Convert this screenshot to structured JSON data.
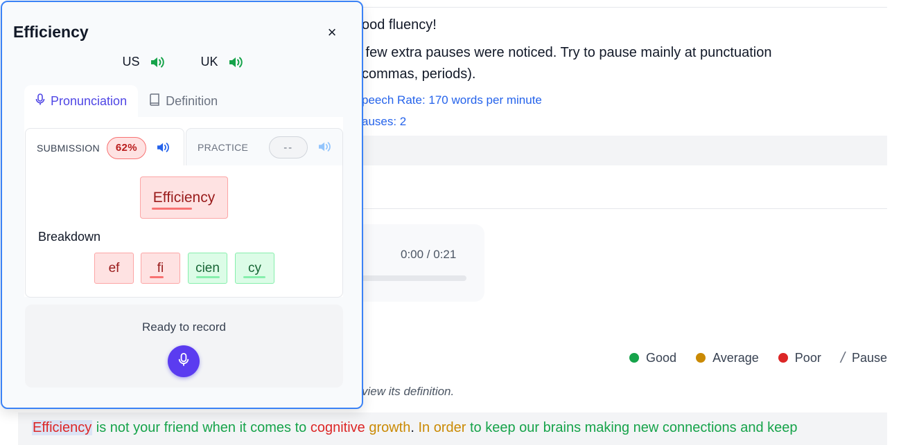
{
  "feedback": {
    "line1": "ood fluency!",
    "line2": " few extra pauses were noticed. Try to pause mainly at punctuation",
    "line3": "commas, periods).",
    "speech_rate": "peech Rate: 170 words per minute",
    "pauses": "auses: 2"
  },
  "audio": {
    "time": "0:00 / 0:21"
  },
  "legend": {
    "items": [
      {
        "label": "Good",
        "color": "#16a34a"
      },
      {
        "label": "Average",
        "color": "#ca8a04"
      },
      {
        "label": "Poor",
        "color": "#dc2626"
      }
    ],
    "pause_glyph": "/",
    "pause_label": "Pause"
  },
  "hint": "view its definition.",
  "passage": [
    {
      "text": "Efficiency",
      "quality": "poor",
      "selected": true
    },
    {
      "text": " is not your friend when it comes to ",
      "quality": "good"
    },
    {
      "text": "cognitive",
      "quality": "poor"
    },
    {
      "text": " ",
      "quality": "good"
    },
    {
      "text": "growth",
      "quality": "avg"
    },
    {
      "text": ". ",
      "quality": "plain"
    },
    {
      "text": "In order",
      "quality": "avg"
    },
    {
      "text": " to keep our brains making new connections and keep",
      "quality": "good"
    }
  ],
  "popup": {
    "title": "Efficiency",
    "close_glyph": "×",
    "accents": [
      {
        "label": "US",
        "icon": "speaker-icon",
        "color": "#16a34a"
      },
      {
        "label": "UK",
        "icon": "speaker-icon",
        "color": "#16a34a"
      }
    ],
    "tabs": [
      {
        "label": "Pronunciation",
        "icon": "mic-icon",
        "active": true
      },
      {
        "label": "Definition",
        "icon": "book-icon",
        "active": false
      }
    ],
    "submission": {
      "label": "SUBMISSION",
      "score": "62%"
    },
    "practice": {
      "label": "PRACTICE",
      "score": "--"
    },
    "word": "Efficiency",
    "breakdown_label": "Breakdown",
    "syllables": [
      {
        "text": "ef",
        "quality": "poor"
      },
      {
        "text": "fi",
        "quality": "poor"
      },
      {
        "text": "cien",
        "quality": "good"
      },
      {
        "text": "cy",
        "quality": "good"
      }
    ],
    "record_status": "Ready to record",
    "colors": {
      "accent": "#5b3cf0",
      "border": "#3b82f6"
    }
  }
}
